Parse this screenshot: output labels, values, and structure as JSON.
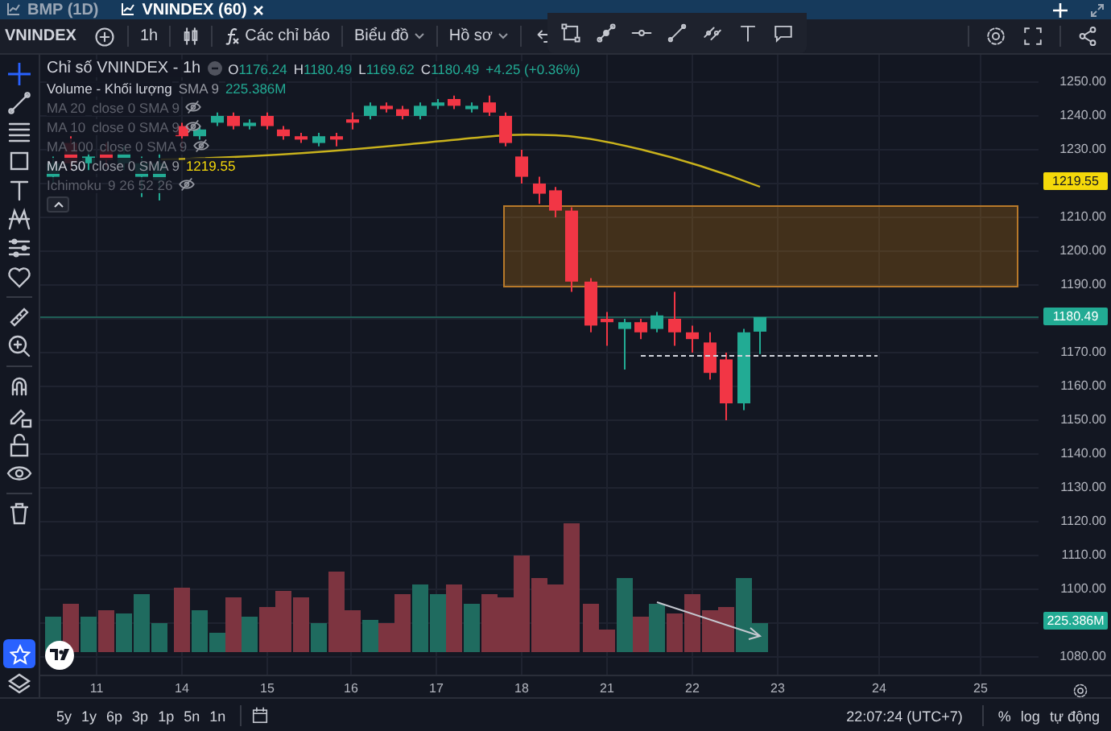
{
  "tabs": [
    {
      "label": "BMP (1D)",
      "selected": false
    },
    {
      "label": "VNINDEX (60)",
      "selected": true
    }
  ],
  "toolbar": {
    "symbol": "VNINDEX",
    "interval": "1h",
    "indicators": "Các chỉ báo",
    "chart_menu": "Biểu đồ",
    "profile_menu": "Hồ sơ"
  },
  "legend": {
    "title": "Chỉ số VNINDEX - 1h",
    "ohlc": [
      {
        "label": "O",
        "value": "1176.24"
      },
      {
        "label": "H",
        "value": "1180.49"
      },
      {
        "label": "L",
        "value": "1169.62"
      },
      {
        "label": "C",
        "value": "1180.49"
      }
    ],
    "change": "+4.25 (+0.36%)",
    "indicators": [
      {
        "name": "Volume - Khối lượng",
        "params": "SMA 9",
        "value": "225.386M",
        "kind": "volume",
        "visible": true
      },
      {
        "name": "MA 20",
        "params": "close 0 SMA 9",
        "visible": false
      },
      {
        "name": "MA 10",
        "params": "close 0 SMA 9",
        "visible": false
      },
      {
        "name": "MA 100",
        "params": "close 0 SMA 9",
        "visible": false
      },
      {
        "name": "MA 50",
        "params": "close 0 SMA 9",
        "value": "1219.55",
        "kind": "ma",
        "visible": true
      },
      {
        "name": "Ichimoku",
        "params": "9 26 52 26",
        "visible": false
      }
    ]
  },
  "price_axis": {
    "labels": [
      "1250.00",
      "1240.00",
      "1230.00",
      "1210.00",
      "1200.00",
      "1190.00",
      "1170.00",
      "1160.00",
      "1150.00",
      "1140.00",
      "1130.00",
      "1120.00",
      "1110.00",
      "1100.00",
      "1080.00"
    ],
    "badges": [
      {
        "text": "1219.55",
        "kind": "ma"
      },
      {
        "text": "1180.49",
        "kind": "price"
      },
      {
        "text": "225.386M",
        "kind": "volume"
      }
    ]
  },
  "time_axis": {
    "labels": [
      "11",
      "14",
      "15",
      "16",
      "17",
      "18",
      "21",
      "22",
      "23",
      "24",
      "25"
    ]
  },
  "bottom_bar": {
    "ranges": [
      "5y",
      "1y",
      "6p",
      "3p",
      "1p",
      "5n",
      "1n"
    ],
    "clock": "22:07:24 (UTC+7)",
    "scale_options": [
      "%",
      "log",
      "tự động"
    ]
  }
}
